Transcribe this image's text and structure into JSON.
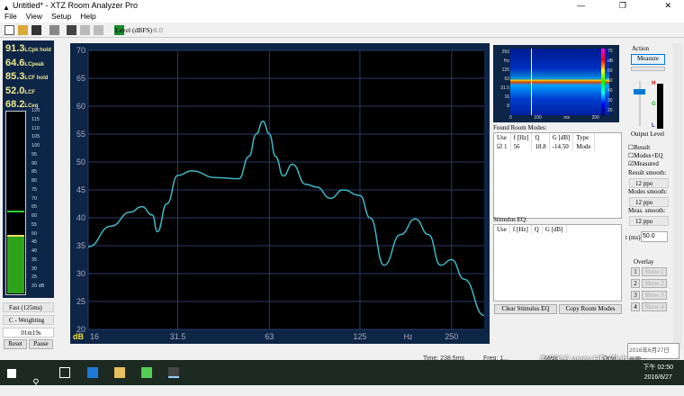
{
  "window": {
    "title": "Untitled* - XTZ Room Analyzer Pro",
    "controls": [
      "—",
      "❐",
      "✕"
    ]
  },
  "menu": [
    "File",
    "View",
    "Setup",
    "Help"
  ],
  "toolbar": {
    "level_label": "Level (dBFS)",
    "level_value": "-6.0",
    "buttons": [
      "new",
      "open",
      "save",
      "print",
      "ssm",
      "rta",
      "sts"
    ]
  },
  "meter": {
    "readings": [
      {
        "value": "91.3",
        "label": "LCpk hold"
      },
      {
        "value": "64.6",
        "label": "LCpeak"
      },
      {
        "value": "85.3",
        "label": "LCF hold"
      },
      {
        "value": "52.0",
        "label": "LCF"
      },
      {
        "value": "68.2",
        "label": "LCeq"
      }
    ],
    "scale": [
      "120",
      "115",
      "110",
      "105",
      "100",
      "95",
      "90",
      "85",
      "80",
      "75",
      "70",
      "65",
      "60",
      "55",
      "50",
      "45",
      "40",
      "35",
      "30",
      "25",
      "20 dB"
    ],
    "level_db": 52,
    "hold_db": 64.6,
    "speed": "Fast (125ms)",
    "weighting": "C - Weighting",
    "time": "01m19s",
    "reset": "Reset",
    "pause": "Pause"
  },
  "chart_data": {
    "type": "line",
    "xscale": "log",
    "xlim": [
      16,
      320
    ],
    "ylim": [
      20,
      70
    ],
    "grid": true,
    "xticks": [
      "16",
      "31.5",
      "63",
      "125",
      "250"
    ],
    "xunit": "Hz",
    "yunit": "dB",
    "yticks": [
      "70",
      "65",
      "60",
      "55",
      "50",
      "45",
      "40",
      "35",
      "30",
      "25",
      "20"
    ],
    "color": "#3fb7c4",
    "x": [
      16,
      19,
      22,
      24,
      26,
      27,
      29,
      31.5,
      35,
      42,
      50,
      54,
      57,
      60,
      63,
      66,
      70,
      75,
      83,
      90,
      100,
      110,
      125,
      135,
      150,
      170,
      190,
      210,
      230,
      250,
      275,
      320
    ],
    "y": [
      34.8,
      38.5,
      41,
      42,
      40.5,
      37.5,
      42.5,
      47.6,
      48.4,
      47.2,
      47,
      51,
      55,
      57.3,
      55,
      51,
      47.5,
      49.6,
      46,
      45.5,
      43.5,
      45,
      44,
      40,
      31.5,
      37,
      39.8,
      37,
      31.5,
      32.5,
      29,
      22.5
    ]
  },
  "spectrogram": {
    "yticks": [
      "250",
      "Hz",
      "125",
      "63",
      "31.5",
      "16",
      "8"
    ],
    "xticks": [
      "0",
      "100",
      "ms",
      "200"
    ],
    "cticks": [
      "70",
      "dB",
      "60",
      "50",
      "40",
      "30",
      "20"
    ]
  },
  "action": {
    "title": "Action",
    "measure": "Measure",
    "output_level": "Output Level",
    "meter_labels": [
      "H",
      "G",
      "L"
    ]
  },
  "room_modes": {
    "title": "Found Room Modes:",
    "headers": [
      "Use",
      "f [Hz]",
      "Q",
      "G [dB]",
      "Type"
    ],
    "rows": [
      [
        "1",
        "56",
        "18.8",
        "-14.50",
        "Mode"
      ]
    ]
  },
  "stimulus": {
    "title": "Stimulus EQ:",
    "headers": [
      "Use",
      "f [Hz]",
      "Q",
      "G [dB]"
    ]
  },
  "options": {
    "checks": [
      {
        "label": "Result",
        "checked": false
      },
      {
        "label": "Modes+EQ",
        "checked": false
      },
      {
        "label": "Measured",
        "checked": true
      }
    ],
    "result_smooth": "Result smooth:",
    "result_smooth_val": "12 ppo",
    "modes_smooth": "Modes smooth:",
    "modes_smooth_val": "12 ppo",
    "meas_smooth": "Meas. smooth:",
    "meas_smooth_val": "12 ppo",
    "t_label": "t (ms)",
    "t_val": "50.0"
  },
  "overlay": {
    "title": "Overlay",
    "items": [
      {
        "n": "1",
        "label": "Show 1"
      },
      {
        "n": "2",
        "label": "Show 2"
      },
      {
        "n": "3",
        "label": "Show 3"
      },
      {
        "n": "4",
        "label": "Show 4"
      }
    ]
  },
  "buttons": {
    "clear": "Clear Stimulus EQ",
    "copy": "Copy Room Modes"
  },
  "status": {
    "time": "Time: 238.5ms",
    "freq": "Freq: 1...",
    "mag": "Mag: ...",
    "dev": "Devi..."
  },
  "watermark": "© 2016  www.HD.Club.tw",
  "tooltip": {
    "date": "2016年6月27日",
    "day": "星期一"
  },
  "taskbar": {
    "time": "下午 02:50",
    "date": "2016/6/27"
  }
}
